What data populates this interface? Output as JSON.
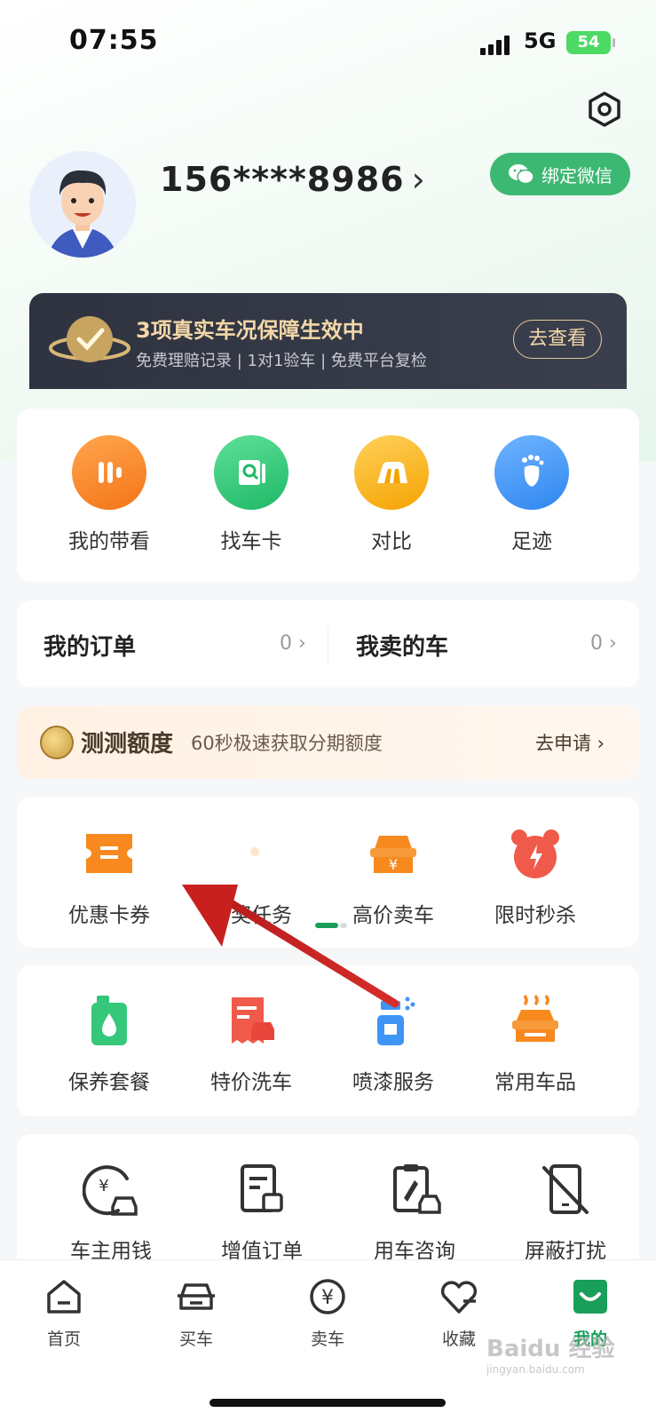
{
  "status_bar": {
    "time": "07:55",
    "network": "5G",
    "battery": "54"
  },
  "profile": {
    "phone": "156****8986",
    "bind_wechat": "绑定微信"
  },
  "guarantee": {
    "title": "3项真实车况保障生效中",
    "subtitle": "免费理赔记录 | 1对1验车 | 免费平台复检",
    "button": "去查看"
  },
  "quick_actions": [
    {
      "label": "我的带看",
      "color": "#f7871f"
    },
    {
      "label": "找车卡",
      "color": "#35c77a"
    },
    {
      "label": "对比",
      "color": "#f7b21f"
    },
    {
      "label": "足迹",
      "color": "#3f95f5"
    }
  ],
  "orders": {
    "my_orders": "我的订单",
    "my_orders_count": "0",
    "cars_sold": "我卖的车",
    "cars_sold_count": "0"
  },
  "credit": {
    "title": "测测额度",
    "subtitle": "60秒极速获取分期额度",
    "link": "去申请"
  },
  "benefits": [
    {
      "label": "优惠卡券",
      "icon": "coupon-icon"
    },
    {
      "label": "有奖任务",
      "icon": "task-icon"
    },
    {
      "label": "高价卖车",
      "icon": "sell-car-icon"
    },
    {
      "label": "限时秒杀",
      "icon": "flash-sale-icon"
    }
  ],
  "services": [
    {
      "label": "保养套餐",
      "icon": "maintenance-icon"
    },
    {
      "label": "特价洗车",
      "icon": "car-wash-icon"
    },
    {
      "label": "喷漆服务",
      "icon": "spray-paint-icon"
    },
    {
      "label": "常用车品",
      "icon": "car-products-icon"
    }
  ],
  "tools": [
    {
      "label": "车主用钱",
      "icon": "car-loan-icon"
    },
    {
      "label": "增值订单",
      "icon": "value-added-order-icon"
    },
    {
      "label": "用车咨询",
      "icon": "consult-icon"
    },
    {
      "label": "屏蔽打扰",
      "icon": "block-disturb-icon"
    }
  ],
  "tabbar": [
    {
      "label": "首页"
    },
    {
      "label": "买车"
    },
    {
      "label": "卖车"
    },
    {
      "label": "收藏"
    },
    {
      "label": "我的",
      "active": true
    }
  ],
  "watermark": {
    "brand": "Baidu 经验",
    "url": "jingyan.baidu.com"
  },
  "colors": {
    "brand_green": "#1a9f5a",
    "annotation_red": "#c8201e"
  }
}
